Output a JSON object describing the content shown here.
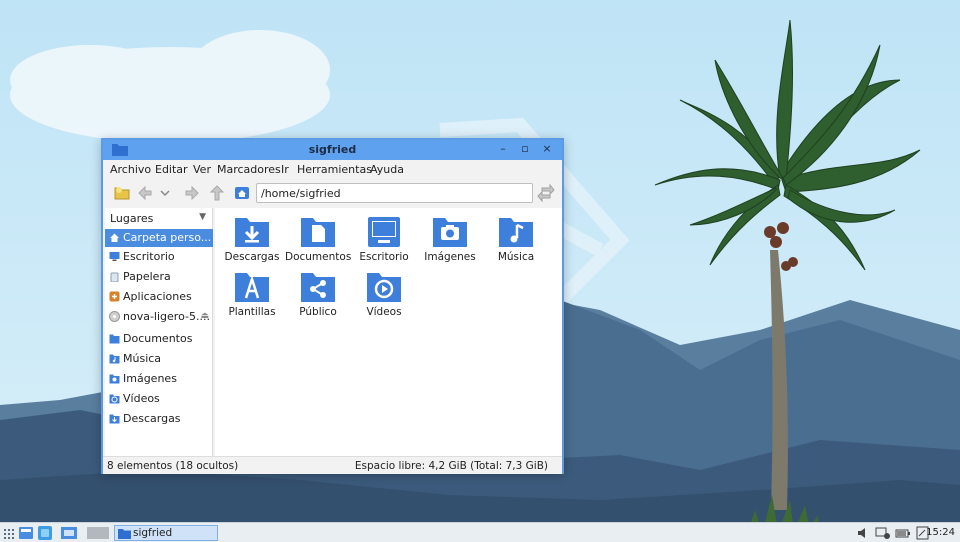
{
  "window": {
    "title": "sigfried",
    "controls": {
      "minimize": "–",
      "maximize": "▫",
      "close": "×"
    }
  },
  "menubar": {
    "items": [
      "Archivo",
      "Editar",
      "Ver",
      "Marcadores",
      "Ir",
      "Herramientas",
      "Ayuda"
    ]
  },
  "toolbar": {
    "address": "/home/sigfried"
  },
  "sidebar": {
    "header": "Lugares",
    "places": [
      {
        "label": "Carpeta perso...",
        "icon": "home-icon"
      },
      {
        "label": "Escritorio",
        "icon": "desktop-icon"
      },
      {
        "label": "Papelera",
        "icon": "trash-icon"
      },
      {
        "label": "Aplicaciones",
        "icon": "applications-icon"
      },
      {
        "label": "nova-ligero-5....",
        "icon": "disc-icon"
      }
    ],
    "bookmarks": [
      {
        "label": "Documentos",
        "icon": "folder-icon"
      },
      {
        "label": "Música",
        "icon": "music-folder-icon"
      },
      {
        "label": "Imágenes",
        "icon": "pictures-folder-icon"
      },
      {
        "label": "Vídeos",
        "icon": "videos-folder-icon"
      },
      {
        "label": "Descargas",
        "icon": "downloads-folder-icon"
      }
    ]
  },
  "files": [
    {
      "label": "Descargas",
      "icon": "download-folder-icon"
    },
    {
      "label": "Documentos",
      "icon": "documents-folder-icon"
    },
    {
      "label": "Escritorio",
      "icon": "desktop-folder-icon"
    },
    {
      "label": "Imágenes",
      "icon": "pictures-folder-icon"
    },
    {
      "label": "Música",
      "icon": "music-folder-icon"
    },
    {
      "label": "Plantillas",
      "icon": "templates-folder-icon"
    },
    {
      "label": "Público",
      "icon": "public-folder-icon"
    },
    {
      "label": "Vídeos",
      "icon": "videos-folder-icon"
    }
  ],
  "status": {
    "left": "8 elementos (18 ocultos)",
    "right": "Espacio libre: 4,2 GiB (Total: 7,3 GiB)"
  },
  "taskbar": {
    "window_label": "sigfried",
    "clock": "15:24"
  },
  "colors": {
    "accent": "#4a8de0",
    "folder": "#3f7fdc",
    "titlebar": "#5ea2ef"
  }
}
